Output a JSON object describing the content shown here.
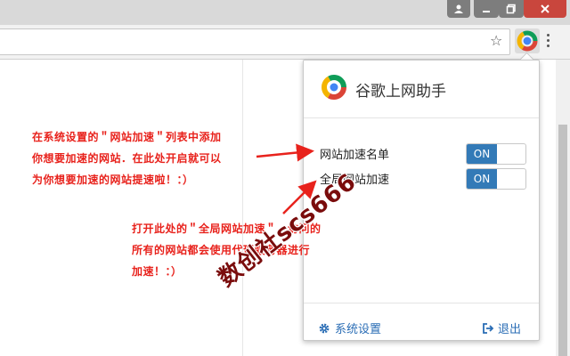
{
  "window": {
    "buttons": [
      "user-icon",
      "minimize-icon",
      "maximize-icon",
      "close-icon"
    ]
  },
  "toolbar": {
    "bookmark_icon": "star-icon",
    "extension_icon": "chrome-logo-icon",
    "menu_icon": "kebab-icon"
  },
  "popup": {
    "title": "谷歌上网助手",
    "options": [
      {
        "label": "网站加速名单",
        "toggle": "ON"
      },
      {
        "label": "全局网站加速",
        "toggle": "ON"
      }
    ],
    "footer": {
      "settings_label": "系统设置",
      "exit_label": "退出"
    }
  },
  "annotations": {
    "note1_lines": [
      "在系统设置的＂网站加速＂列表中添加",
      "你想要加速的网站．在此处开启就可以",
      "为你想要加速的网站提速啦！：）"
    ],
    "note2_lines": [
      "打开此处的＂全局网站加速＂，访问的",
      "所有的网站都会使用代理服务器进行",
      "加速！：）"
    ],
    "watermark": "数创社scs666"
  },
  "colors": {
    "annotation_red": "#e8221c",
    "toggle_blue": "#337ab7",
    "link_blue": "#2a6db5",
    "close_red": "#c9463d"
  }
}
